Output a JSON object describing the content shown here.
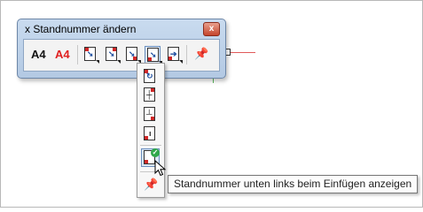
{
  "palette": {
    "title": "x Standnummer ändern",
    "close_glyph": "x",
    "text_button_a": "A4",
    "text_button_b": "A4",
    "buttons": [
      {
        "icon": "page-arrow-icon"
      },
      {
        "icon": "page-arrow-icon"
      },
      {
        "icon": "page-arrow-icon"
      },
      {
        "icon": "page-arrow-icon"
      },
      {
        "icon": "page-arrow-icon"
      },
      {
        "icon": "pushpin-icon"
      }
    ]
  },
  "menu": {
    "items": [
      {
        "icon": "page-rotate-icon"
      },
      {
        "icon": "page-center-icon"
      },
      {
        "icon": "page-bottom-line-icon"
      },
      {
        "icon": "page-info-icon"
      },
      {
        "icon": "page-bottom-left-check-icon",
        "active": true
      },
      {
        "icon": "pushpin-icon"
      }
    ]
  },
  "tooltip": {
    "text": "Standnummer unten links beim Einfügen anzeigen"
  },
  "colors": {
    "title_bar": "#b3c9e3",
    "accent_red": "#e02020",
    "guide_red": "#e05a5a",
    "guide_green": "#5cb85c"
  }
}
